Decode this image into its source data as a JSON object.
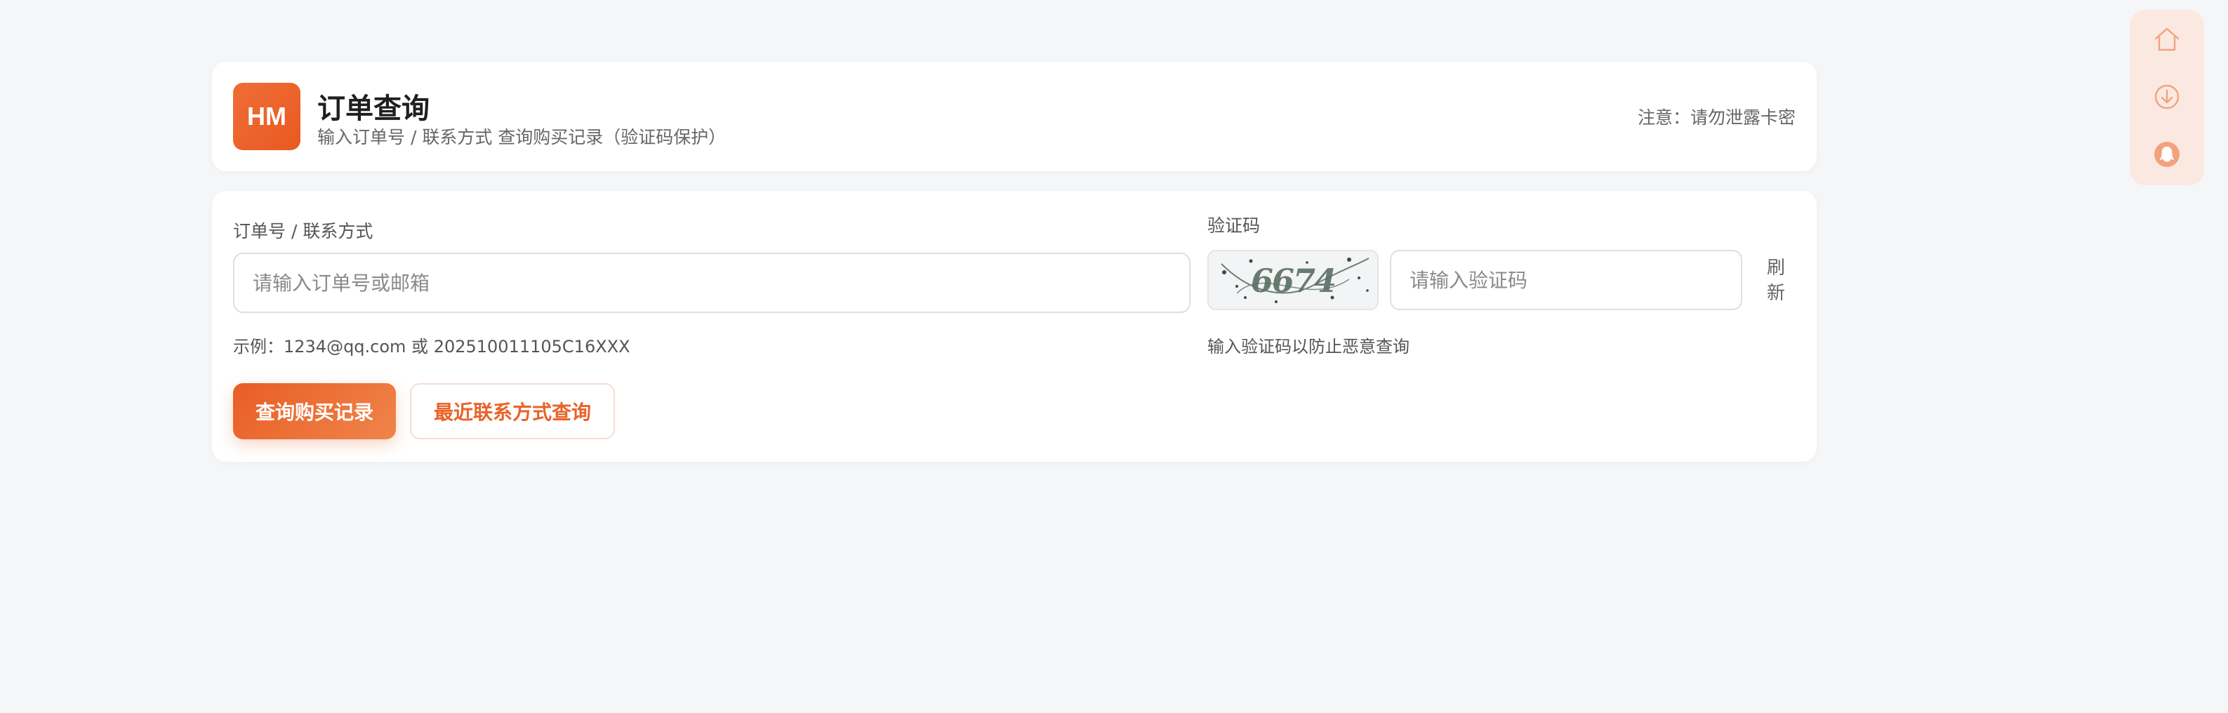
{
  "header": {
    "logo_text": "HM",
    "title": "订单查询",
    "subtitle": "输入订单号 / 联系方式 查询购买记录（验证码保护）",
    "notice": "注意：请勿泄露卡密"
  },
  "form": {
    "order_label": "订单号 / 联系方式",
    "order_placeholder": "请输入订单号或邮箱",
    "order_value": "",
    "order_hint": "示例：1234@qq.com 或 202510011105C16XXX",
    "captcha_label": "验证码",
    "captcha_text": "6674",
    "captcha_placeholder": "请输入验证码",
    "captcha_value": "",
    "refresh_label": "刷新",
    "captcha_hint": "输入验证码以防止恶意查询",
    "query_button": "查询购买记录",
    "recent_button": "最近联系方式查询"
  },
  "side_toolbar": {
    "icons": [
      "home-icon",
      "download-icon",
      "qq-penguin-icon"
    ]
  },
  "colors": {
    "accent": "#E8632A",
    "background": "#F5F6F8",
    "toolbar_bg": "#FBE9E1",
    "toolbar_icon": "#F2A27E"
  }
}
